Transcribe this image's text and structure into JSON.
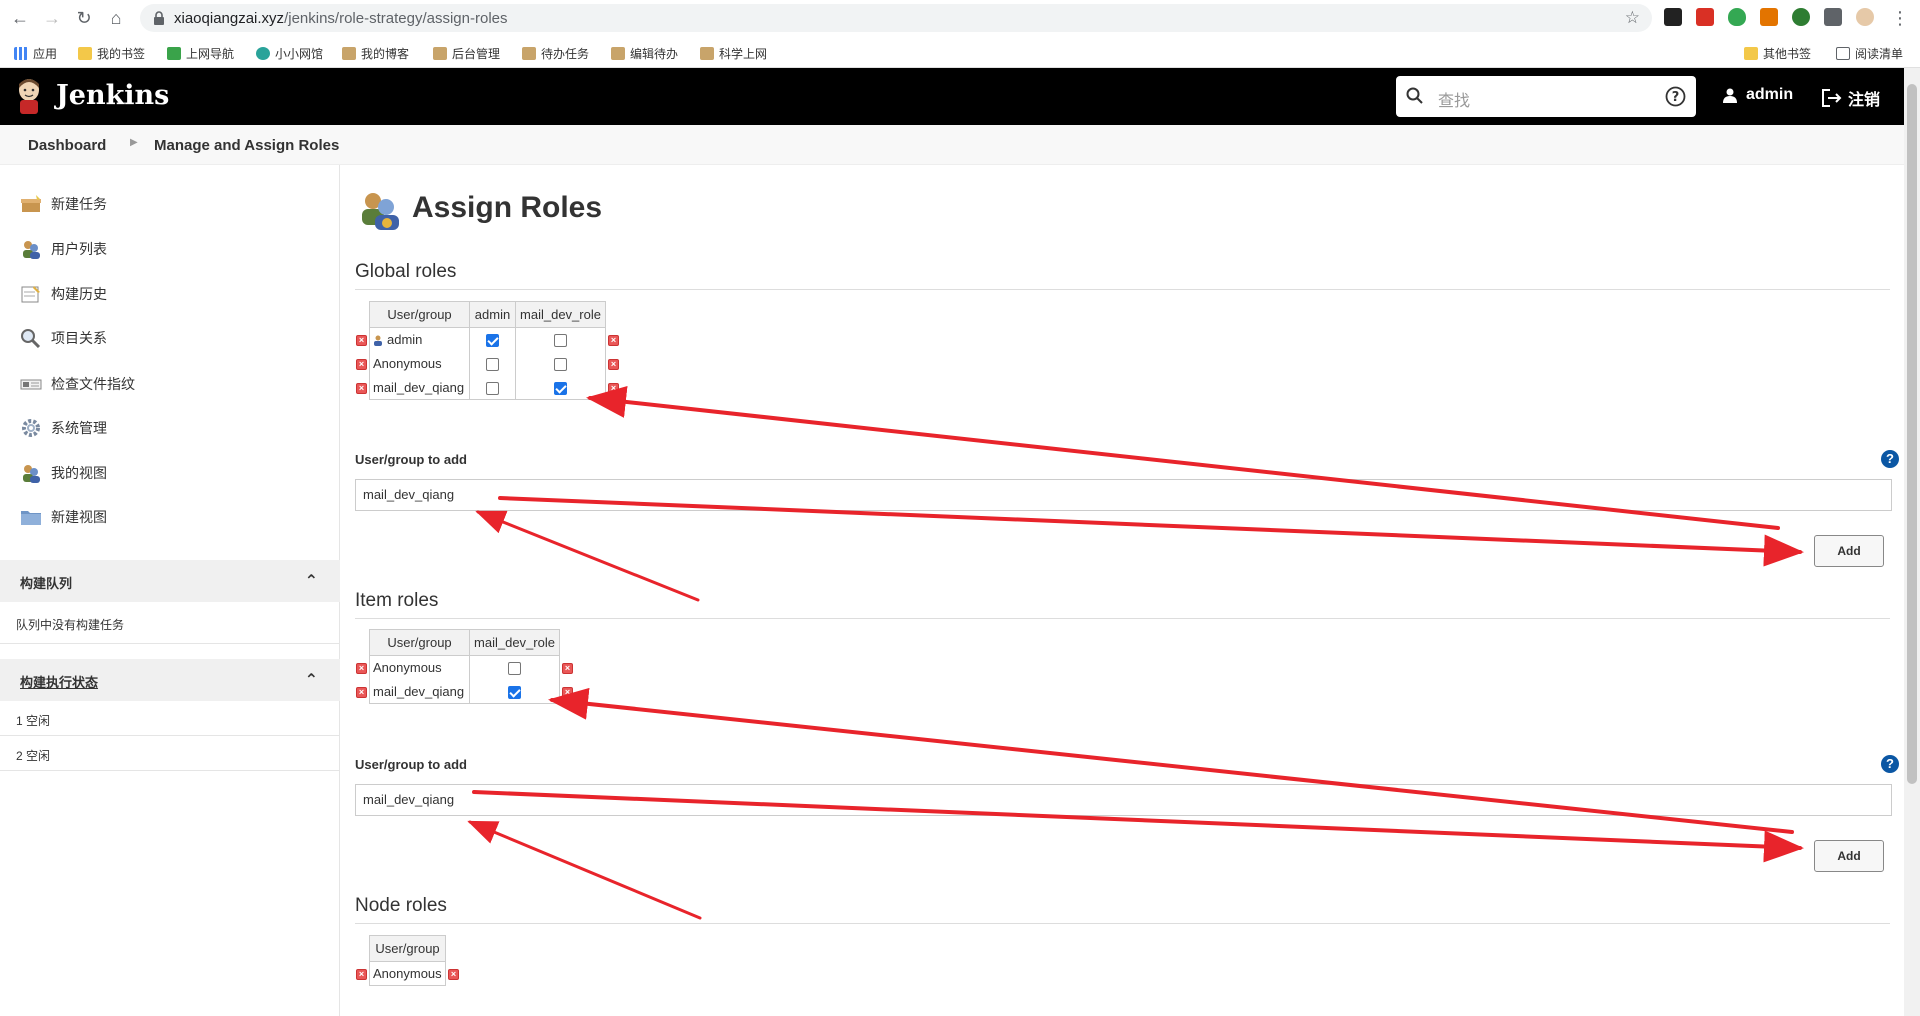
{
  "browser": {
    "url_host": "xiaoqiangzai.xyz",
    "url_path": "/jenkins/role-strategy/assign-roles",
    "bookmarks": [
      "应用",
      "我的书签",
      "上网导航",
      "小小网馆",
      "我的博客",
      "后台管理",
      "待办任务",
      "编辑待办",
      "科学上网"
    ],
    "other_bookmarks": "其他书签",
    "reading_list": "阅读清单"
  },
  "header": {
    "brand": "Jenkins",
    "search_placeholder": "查找",
    "user": "admin",
    "logout": "注销"
  },
  "breadcrumb": [
    "Dashboard",
    "Manage and Assign Roles"
  ],
  "sidebar": {
    "tasks": [
      "新建任务",
      "用户列表",
      "构建历史",
      "项目关系",
      "检查文件指纹",
      "系统管理",
      "我的视图",
      "新建视图"
    ],
    "build_queue": {
      "title": "构建队列",
      "empty": "队列中没有构建任务"
    },
    "executors": {
      "title": "构建执行状态",
      "rows": [
        "1  空闲",
        "2  空闲"
      ]
    }
  },
  "main": {
    "title": "Assign Roles",
    "global": {
      "heading": "Global roles",
      "header_user": "User/group",
      "roles": [
        "admin",
        "mail_dev_role"
      ],
      "rows": [
        {
          "name": "admin",
          "checks": [
            true,
            false
          ]
        },
        {
          "name": "Anonymous",
          "checks": [
            false,
            false
          ]
        },
        {
          "name": "mail_dev_qiang",
          "checks": [
            false,
            true
          ]
        }
      ],
      "add_label": "User/group to add",
      "add_value": "mail_dev_qiang",
      "add_button": "Add"
    },
    "item": {
      "heading": "Item roles",
      "header_user": "User/group",
      "roles": [
        "mail_dev_role"
      ],
      "rows": [
        {
          "name": "Anonymous",
          "checks": [
            false
          ]
        },
        {
          "name": "mail_dev_qiang",
          "checks": [
            true
          ]
        }
      ],
      "add_label": "User/group to add",
      "add_value": "mail_dev_qiang",
      "add_button": "Add"
    },
    "node": {
      "heading": "Node roles",
      "header_user": "User/group",
      "rows": [
        {
          "name": "Anonymous"
        }
      ]
    }
  },
  "colors": {
    "header_bg": "#000000",
    "annotation_arrow": "#e8242b",
    "checkbox_on": "#1a73e8"
  }
}
